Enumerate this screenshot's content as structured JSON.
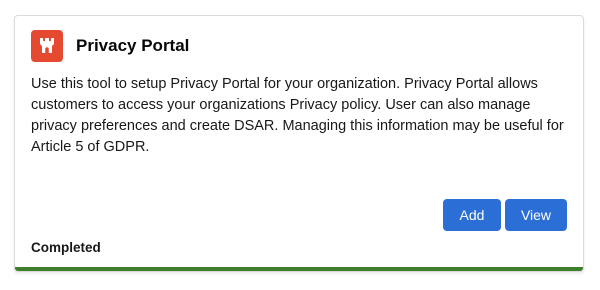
{
  "card": {
    "title": "Privacy Portal",
    "icon": "castle-tower-icon",
    "icon_color": "#e5492f",
    "description": "Use this tool to setup Privacy Portal for your organization. Privacy Portal allows customers to access your organizations Privacy policy. User can also manage privacy preferences and create DSAR. Managing this information may be useful for Article 5 of GDPR.",
    "actions": {
      "add_label": "Add",
      "view_label": "View",
      "button_color": "#2b6fd6"
    },
    "status": "Completed",
    "progress": {
      "value": 1.0,
      "color": "#3d7f2a"
    }
  }
}
